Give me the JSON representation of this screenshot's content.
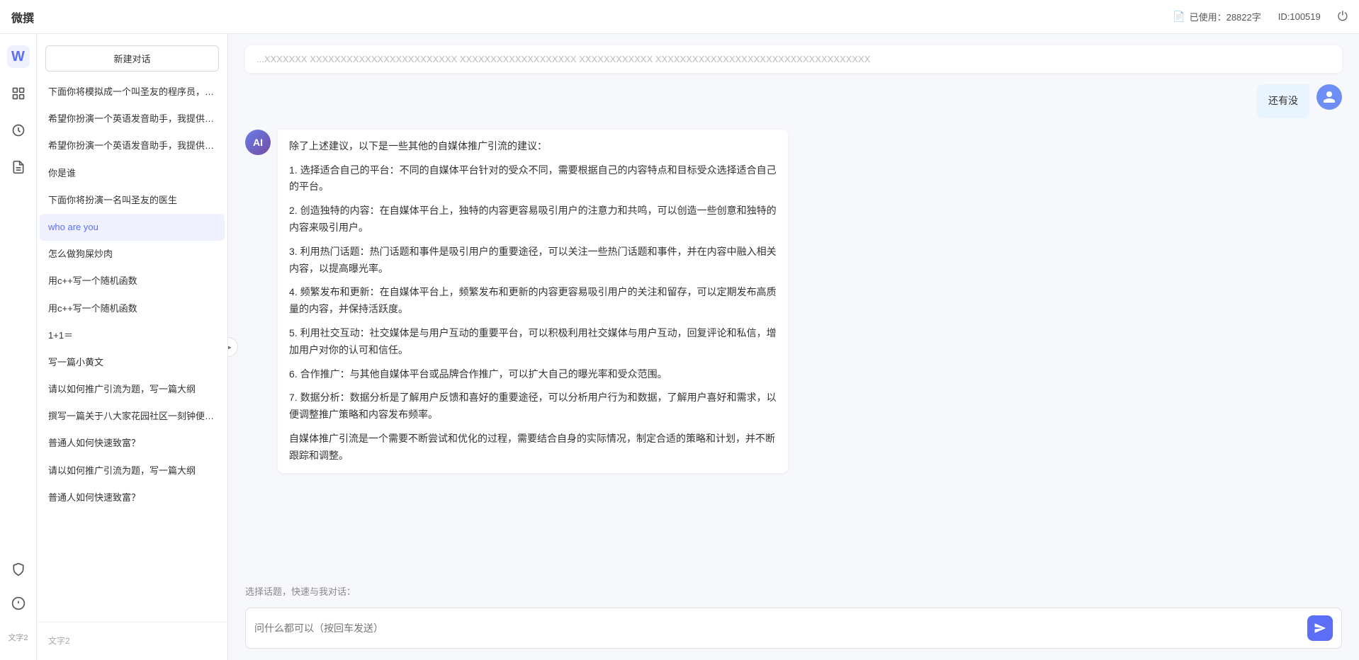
{
  "topbar": {
    "logo": "微撰",
    "usage_label": "已使用：28822字",
    "id_label": "ID:100519",
    "usage_icon": "document-icon",
    "power_icon": "power-icon"
  },
  "sidebar_icons": [
    {
      "name": "home-icon",
      "symbol": "⊞",
      "active": false
    },
    {
      "name": "cube-icon",
      "symbol": "◈",
      "active": false
    },
    {
      "name": "clock-icon",
      "symbol": "⊙",
      "active": false
    },
    {
      "name": "doc-icon",
      "symbol": "☰",
      "active": false
    }
  ],
  "sidebar_bottom_icons": [
    {
      "name": "shield-icon",
      "symbol": "⊕"
    },
    {
      "name": "info-icon",
      "symbol": "ⓘ"
    },
    {
      "name": "bottom-text",
      "symbol": "文字2"
    }
  ],
  "conv_list": {
    "new_btn_label": "新建对话",
    "items": [
      {
        "id": "1",
        "text": "下面你将模拟成一个叫圣友的程序员，我说...",
        "active": false
      },
      {
        "id": "2",
        "text": "希望你扮演一个英语发音助手，我提供给你...",
        "active": false
      },
      {
        "id": "3",
        "text": "希望你扮演一个英语发音助手，我提供给你...",
        "active": false
      },
      {
        "id": "4",
        "text": "你是谁",
        "active": false
      },
      {
        "id": "5",
        "text": "下面你将扮演一名叫圣友的医生",
        "active": false
      },
      {
        "id": "6",
        "text": "who are you",
        "active": true
      },
      {
        "id": "7",
        "text": "怎么做狗屎炒肉",
        "active": false
      },
      {
        "id": "8",
        "text": "用c++写一个随机函数",
        "active": false
      },
      {
        "id": "9",
        "text": "用c++写一个随机函数",
        "active": false
      },
      {
        "id": "10",
        "text": "1+1＝",
        "active": false
      },
      {
        "id": "11",
        "text": "写一篇小黄文",
        "active": false
      },
      {
        "id": "12",
        "text": "请以如何推广引流为题，写一篇大纲",
        "active": false
      },
      {
        "id": "13",
        "text": "撰写一篇关于八大家花园社区一刻钟便民生...",
        "active": false
      },
      {
        "id": "14",
        "text": "普通人如何快速致富？",
        "active": false
      },
      {
        "id": "15",
        "text": "请以如何推广引流为题，写一篇大纲",
        "active": false
      },
      {
        "id": "16",
        "text": "普通人如何快速致富？",
        "active": false
      }
    ],
    "bottom_items": [
      {
        "id": "b1",
        "text": "文字2"
      }
    ]
  },
  "chat": {
    "messages": [
      {
        "role": "truncated",
        "text": "...XXXXXXX  XXXXXXXXXXXXXXXXXXXXXXXX  XXXXXXXXXXXXXXXXXXX  XXXXXXXXXXXX  XXXXXXXXXXXXXXXXXXXXXXXXXXXXXXXXXXX"
      },
      {
        "role": "user",
        "text": "还有没",
        "avatar": "user"
      },
      {
        "role": "ai",
        "text_paragraphs": [
          "除了上述建议，以下是一些其他的自媒体推广引流的建议：",
          "1. 选择适合自己的平台：不同的自媒体平台针对的受众不同，需要根据自己的内容特点和目标受众选择适合自己的平台。",
          "2. 创造独特的内容：在自媒体平台上，独特的内容更容易吸引用户的注意力和共鸣，可以创造一些创意和独特的内容来吸引用户。",
          "3. 利用热门话题：热门话题和事件是吸引用户的重要途径，可以关注一些热门话题和事件，并在内容中融入相关内容，以提高曝光率。",
          "4. 频繁发布和更新：在自媒体平台上，频繁发布和更新的内容更容易吸引用户的关注和留存，可以定期发布高质量的内容，并保持活跃度。",
          "5. 利用社交互动：社交媒体是与用户互动的重要平台，可以积极利用社交媒体与用户互动，回复评论和私信，增加用户对你的认可和信任。",
          "6. 合作推广：与其他自媒体平台或品牌合作推广，可以扩大自己的曝光率和受众范围。",
          "7. 数据分析：数据分析是了解用户反馈和喜好的重要途径，可以分析用户行为和数据，了解用户喜好和需求，以便调整推广策略和内容发布频率。",
          "自媒体推广引流是一个需要不断尝试和优化的过程，需要结合自身的实际情况，制定合适的策略和计划，并不断跟踪和调整。"
        ]
      }
    ],
    "topic_bar_label": "选择话题，快速与我对话：",
    "input_placeholder": "问什么都可以（按回车发送）",
    "send_icon": "send-icon"
  }
}
